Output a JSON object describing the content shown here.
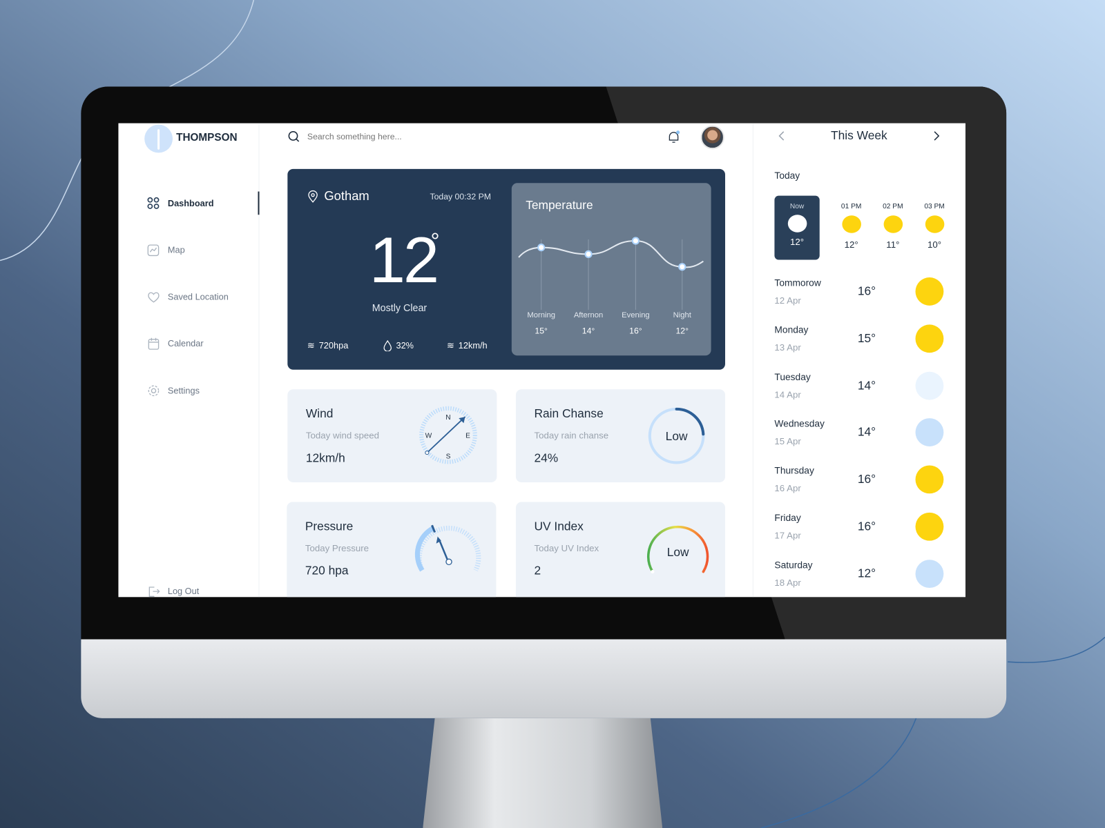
{
  "app": {
    "brand": "THOMPSON"
  },
  "sidebar": {
    "items": [
      {
        "label": "Dashboard",
        "icon": "grid-icon",
        "active": true
      },
      {
        "label": "Map",
        "icon": "chart-icon"
      },
      {
        "label": "Saved Location",
        "icon": "heart-icon"
      },
      {
        "label": "Calendar",
        "icon": "calendar-icon"
      },
      {
        "label": "Settings",
        "icon": "gear-icon"
      }
    ],
    "logout": "Log Out"
  },
  "header": {
    "search_placeholder": "Search something here..."
  },
  "current": {
    "city": "Gotham",
    "time": "Today 00:32 PM",
    "temp": "12",
    "degree": "°",
    "condition": "Mostly Clear",
    "pressure": "720hpa",
    "humidity": "32%",
    "wind": "12km/h"
  },
  "temperature": {
    "title": "Temperature",
    "periods": [
      {
        "label": "Morning",
        "value": "15°",
        "v": 15
      },
      {
        "label": "Afternon",
        "value": "14°",
        "v": 14
      },
      {
        "label": "Evening",
        "value": "16°",
        "v": 16
      },
      {
        "label": "Night",
        "value": "12°",
        "v": 12
      }
    ]
  },
  "cards": {
    "wind": {
      "title": "Wind",
      "subtitle": "Today wind speed",
      "value": "12km/h",
      "compass": {
        "n": "N",
        "e": "E",
        "s": "S",
        "w": "W"
      }
    },
    "rain": {
      "title": "Rain Chanse",
      "subtitle": "Today rain chanse",
      "value": "24%",
      "gauge": "Low",
      "percent": 24
    },
    "pressure": {
      "title": "Pressure",
      "subtitle": "Today Pressure",
      "value": "720 hpa"
    },
    "uv": {
      "title": "UV Index",
      "subtitle": "Today UV Index",
      "value": "2",
      "gauge": "Low"
    }
  },
  "week": {
    "title": "This Week",
    "today_label": "Today",
    "hourly": [
      {
        "time": "Now",
        "temp": "12°"
      },
      {
        "time": "01 PM",
        "temp": "12°"
      },
      {
        "time": "02 PM",
        "temp": "11°"
      },
      {
        "time": "03 PM",
        "temp": "10°"
      }
    ],
    "days": [
      {
        "day": "Tommorow",
        "date": "12 Apr",
        "temp": "16°",
        "icon": "sun",
        "color": "#fdd40f"
      },
      {
        "day": "Monday",
        "date": "13 Apr",
        "temp": "15°",
        "icon": "sun",
        "color": "#fdd40f"
      },
      {
        "day": "Tuesday",
        "date": "14 Apr",
        "temp": "14°",
        "icon": "cloud",
        "color": "#eaf4fe"
      },
      {
        "day": "Wednesday",
        "date": "15 Apr",
        "temp": "14°",
        "icon": "cloud",
        "color": "#c8e1fb"
      },
      {
        "day": "Thursday",
        "date": "16 Apr",
        "temp": "16°",
        "icon": "sun",
        "color": "#fdd40f"
      },
      {
        "day": "Friday",
        "date": "17 Apr",
        "temp": "16°",
        "icon": "sun",
        "color": "#fdd40f"
      },
      {
        "day": "Saturday",
        "date": "18 Apr",
        "temp": "12°",
        "icon": "cloud",
        "color": "#c8e1fb"
      }
    ]
  }
}
